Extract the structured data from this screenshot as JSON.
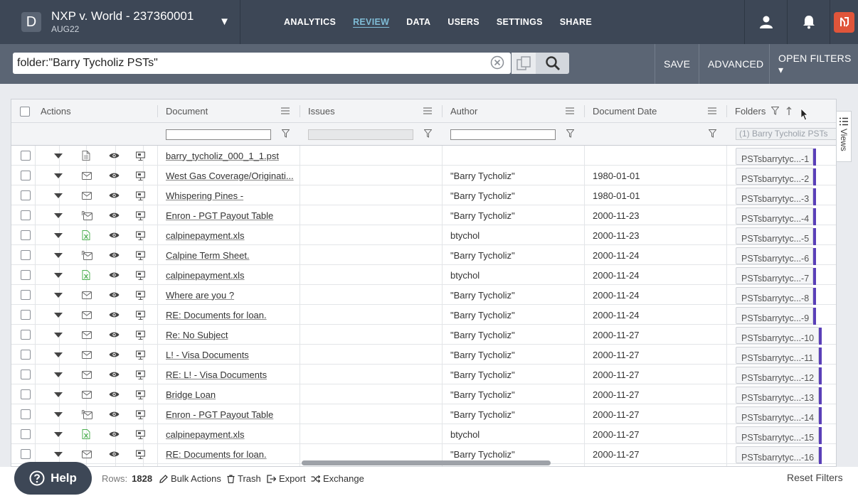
{
  "project": {
    "initial": "D",
    "title": "NXP v. World - 237360001",
    "subtitle": "AUG22"
  },
  "nav": [
    "ANALYTICS",
    "REVIEW",
    "DATA",
    "USERS",
    "SETTINGS",
    "SHARE"
  ],
  "active_nav": "REVIEW",
  "search": {
    "value": "folder:\"Barry Tycholiz PSTs\""
  },
  "buttons": {
    "save": "SAVE",
    "advanced": "ADVANCED",
    "open_filters": "OPEN FILTERS ▾"
  },
  "columns": {
    "actions": "Actions",
    "document": "Document",
    "issues": "Issues",
    "author": "Author",
    "document_date": "Document Date",
    "folders": "Folders"
  },
  "folder_filter": "(1) Barry Tycholiz PSTs",
  "rows": [
    {
      "icon": "file",
      "doc": "barry_tycholiz_000_1_1.pst",
      "author": "",
      "date": "",
      "folder": "PSTsbarrytyc...-1"
    },
    {
      "icon": "mail",
      "doc": "West Gas Coverage/Originati...",
      "author": "\"Barry Tycholiz\"",
      "date": "1980-01-01",
      "folder": "PSTsbarrytyc...-2"
    },
    {
      "icon": "mail",
      "doc": "Whispering Pines -",
      "author": "\"Barry Tycholiz\"",
      "date": "1980-01-01",
      "folder": "PSTsbarrytyc...-3"
    },
    {
      "icon": "attach",
      "doc": "Enron - PGT Payout Table",
      "author": "\"Barry Tycholiz\"",
      "date": "2000-11-23",
      "folder": "PSTsbarrytyc...-4"
    },
    {
      "icon": "xls",
      "doc": "calpinepayment.xls",
      "author": "btychol",
      "date": "2000-11-23",
      "folder": "PSTsbarrytyc...-5"
    },
    {
      "icon": "attach",
      "doc": "Calpine Term Sheet.",
      "author": "\"Barry Tycholiz\"",
      "date": "2000-11-24",
      "folder": "PSTsbarrytyc...-6"
    },
    {
      "icon": "xls",
      "doc": "calpinepayment.xls",
      "author": "btychol",
      "date": "2000-11-24",
      "folder": "PSTsbarrytyc...-7"
    },
    {
      "icon": "mail",
      "doc": "Where are you ?",
      "author": "\"Barry Tycholiz\"",
      "date": "2000-11-24",
      "folder": "PSTsbarrytyc...-8"
    },
    {
      "icon": "mail",
      "doc": "RE: Documents for loan.",
      "author": "\"Barry Tycholiz\"",
      "date": "2000-11-24",
      "folder": "PSTsbarrytyc...-9"
    },
    {
      "icon": "mail",
      "doc": "Re: No Subject",
      "author": "\"Barry Tycholiz\"",
      "date": "2000-11-27",
      "folder": "PSTsbarrytyc...-10"
    },
    {
      "icon": "mail",
      "doc": "L! - Visa Documents",
      "author": "\"Barry Tycholiz\"",
      "date": "2000-11-27",
      "folder": "PSTsbarrytyc...-11"
    },
    {
      "icon": "mail",
      "doc": "RE: L! - Visa Documents",
      "author": "\"Barry Tycholiz\"",
      "date": "2000-11-27",
      "folder": "PSTsbarrytyc...-12"
    },
    {
      "icon": "mail",
      "doc": "Bridge Loan",
      "author": "\"Barry Tycholiz\"",
      "date": "2000-11-27",
      "folder": "PSTsbarrytyc...-13"
    },
    {
      "icon": "attach",
      "doc": "Enron - PGT Payout Table",
      "author": "\"Barry Tycholiz\"",
      "date": "2000-11-27",
      "folder": "PSTsbarrytyc...-14"
    },
    {
      "icon": "xls",
      "doc": "calpinepayment.xls",
      "author": "btychol",
      "date": "2000-11-27",
      "folder": "PSTsbarrytyc...-15"
    },
    {
      "icon": "mail",
      "doc": "RE: Documents for loan.",
      "author": "\"Barry Tycholiz\"",
      "date": "2000-11-27",
      "folder": "PSTsbarrytyc...-16"
    }
  ],
  "views_label": "Views",
  "footer": {
    "help": "Help",
    "rows_label": "Rows:",
    "rows_count": "1828",
    "bulk_actions": "Bulk Actions",
    "trash": "Trash",
    "export": "Export",
    "exchange": "Exchange",
    "reset_filters": "Reset Filters"
  },
  "colors": {
    "topbar": "#3d4756",
    "searchbar": "#5b6574",
    "accent": "#7fbcd6",
    "brand": "#e0553a",
    "folder_bar": "#5a3fb8"
  }
}
